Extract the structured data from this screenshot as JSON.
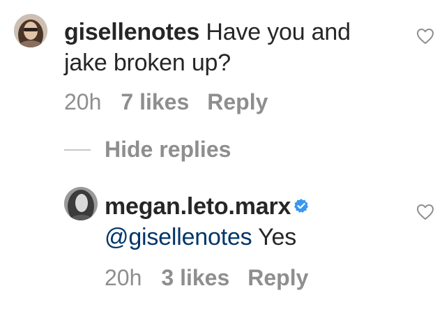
{
  "comments": [
    {
      "username": "gisellenotes",
      "text": "Have you and jake broken up?",
      "time": "20h",
      "likes": "7 likes",
      "reply": "Reply",
      "verified": false
    },
    {
      "username": "megan.leto.marx",
      "mention": "@gisellenotes",
      "text": "Yes",
      "time": "20h",
      "likes": "3 likes",
      "reply": "Reply",
      "verified": true
    }
  ],
  "thread": {
    "hide_replies_label": "Hide replies"
  },
  "colors": {
    "text": "#262626",
    "meta": "#8e8e8e",
    "mention": "#003569",
    "verified": "#3897f0"
  },
  "icons": {
    "like": "heart-outline-icon",
    "verified": "verified-badge-icon"
  }
}
